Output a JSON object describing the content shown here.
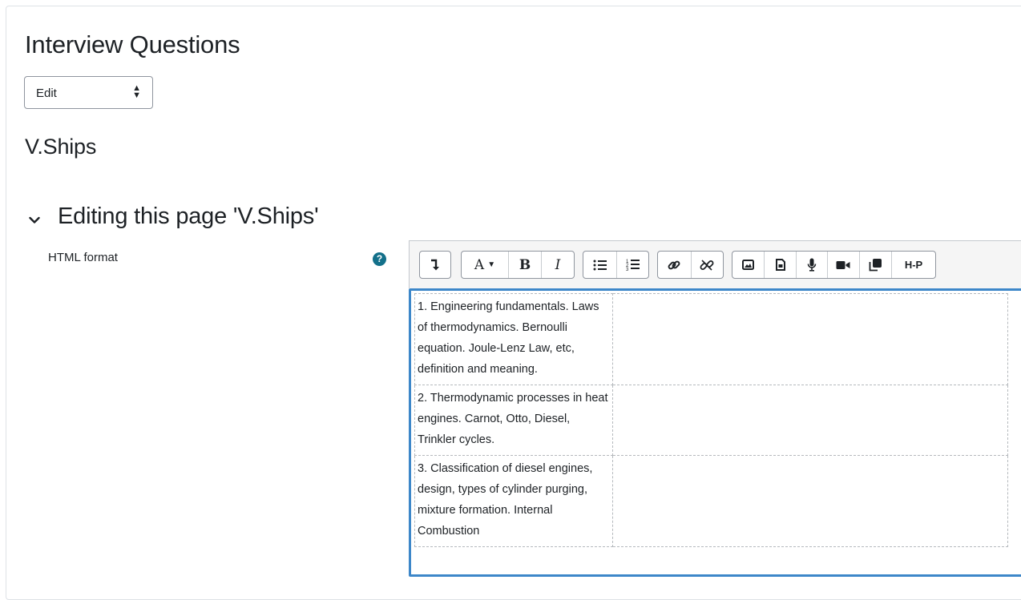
{
  "page": {
    "title": "Interview Questions",
    "mode_select": {
      "value": "Edit",
      "arrow_icon": "sort-arrows-icon"
    },
    "subheading": "V.Ships",
    "section": {
      "chevron_icon": "chevron-down-icon",
      "title": "Editing this page 'V.Ships'"
    }
  },
  "form": {
    "format_label": "HTML format",
    "help_icon": "question-circle-icon",
    "help_glyph": "?",
    "help_color": "#13708a"
  },
  "toolbar": {
    "groups": [
      {
        "buttons": [
          {
            "name": "toggle-toolbar-button",
            "icon": "arrow-down-turn-icon"
          }
        ]
      },
      {
        "buttons": [
          {
            "name": "paragraph-styles-button",
            "icon": "font-style-icon",
            "text": "A"
          },
          {
            "name": "bold-button",
            "icon": "bold-icon",
            "text": "B"
          },
          {
            "name": "italic-button",
            "icon": "italic-icon",
            "text": "I"
          }
        ]
      },
      {
        "buttons": [
          {
            "name": "unordered-list-button",
            "icon": "unordered-list-icon"
          },
          {
            "name": "ordered-list-button",
            "icon": "ordered-list-icon"
          }
        ]
      },
      {
        "buttons": [
          {
            "name": "link-button",
            "icon": "link-icon"
          },
          {
            "name": "unlink-button",
            "icon": "unlink-icon"
          }
        ]
      },
      {
        "buttons": [
          {
            "name": "image-button",
            "icon": "image-icon"
          },
          {
            "name": "media-button",
            "icon": "file-icon"
          },
          {
            "name": "record-audio-button",
            "icon": "microphone-icon"
          },
          {
            "name": "record-video-button",
            "icon": "video-camera-icon"
          },
          {
            "name": "manage-files-button",
            "icon": "copy-files-icon"
          },
          {
            "name": "h5p-button",
            "icon": "h5p-icon",
            "text": "H-P"
          }
        ]
      }
    ]
  },
  "editor": {
    "border_color": "#3d87c9",
    "rows": [
      {
        "question": "1. Engineering fundamentals. Laws of thermodynamics. Bernoulli equation. Joule-Lenz Law, etc, definition and meaning.",
        "answer": ""
      },
      {
        "question": "2. Thermodynamic processes in heat engines. Carnot, Otto, Diesel, Trinkler cycles.",
        "answer": ""
      },
      {
        "question": "3. Classification of diesel engines, design, types of cylinder purging, mixture formation. Internal Combustion",
        "answer": ""
      }
    ]
  }
}
